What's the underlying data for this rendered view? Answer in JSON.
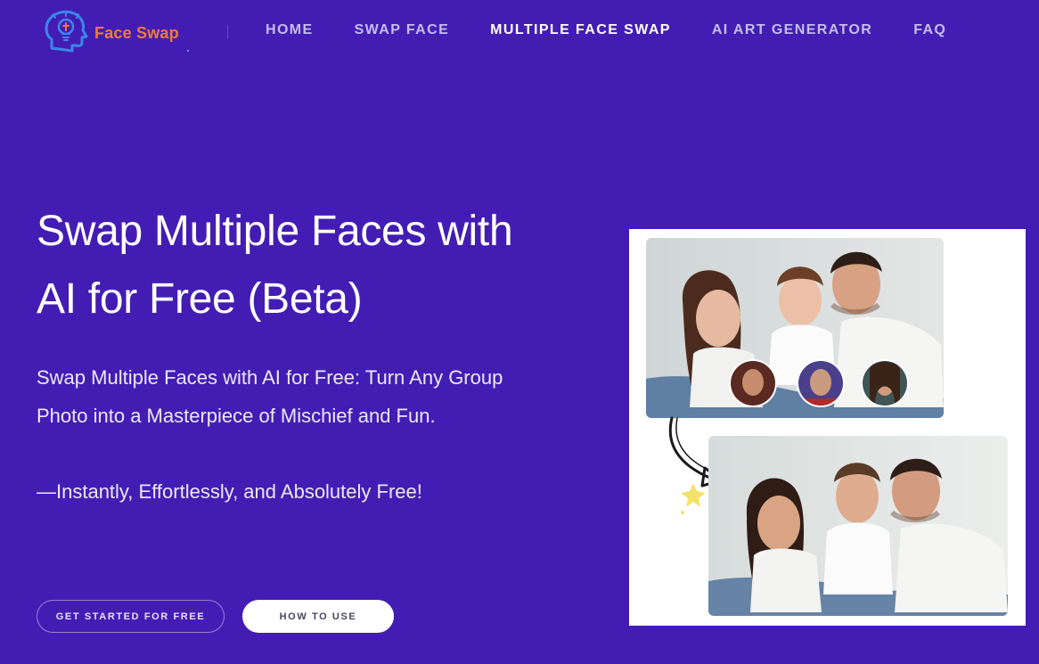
{
  "logo": {
    "text": "Face Swap",
    "icon": "lightbulb-head-icon",
    "color": "#f07a3c"
  },
  "nav": {
    "items": [
      {
        "label": "HOME",
        "active": false
      },
      {
        "label": "SWAP FACE",
        "active": false
      },
      {
        "label": "MULTIPLE FACE SWAP",
        "active": true
      },
      {
        "label": "AI ART GENERATOR",
        "active": false
      },
      {
        "label": "FAQ",
        "active": false
      }
    ]
  },
  "hero": {
    "title_line1": "Swap Multiple Faces with",
    "title_line2": "AI for Free (Beta)",
    "subtitle_line1": "Swap Multiple Faces with AI for Free: Turn Any Group",
    "subtitle_line2": "Photo into a Masterpiece of Mischief and Fun.",
    "tagline": "—Instantly, Effortlessly, and Absolutely Free!"
  },
  "buttons": {
    "primary": "GET STARTED FOR FREE",
    "secondary": "HOW TO USE"
  },
  "illustration": {
    "icons": [
      "group-photo-original",
      "face-thumbnail",
      "curved-arrow-icon",
      "sparkle-icon",
      "group-photo-swapped"
    ]
  },
  "colors": {
    "background": "#431db3",
    "nav_text": "#c5bdf0",
    "nav_active": "#ffffff",
    "button_secondary_bg": "#ffffff"
  }
}
